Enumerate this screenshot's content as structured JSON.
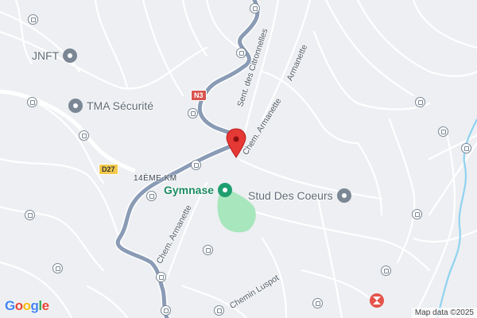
{
  "map": {
    "pois": {
      "jnft": "JNFT",
      "tma": "TMA Sécurité",
      "gymnase": "Gymnase",
      "stud": "Stud Des Coeurs"
    },
    "roads": {
      "sent_citronnelles": "Sent. des Citronnelles",
      "armanette": "Armanette",
      "chem_armanette_upper": "Chem. Armanette",
      "chem_armanette_lower": "Chem. Armanette",
      "chemin_luspot": "Chemin Luspot"
    },
    "shields": {
      "n3": "N3",
      "d27": "D27"
    },
    "km_marker": "14ÈME KM",
    "logo": "Google",
    "attribution": "Map data ©2025",
    "colors": {
      "main_road": "#8a9bb5",
      "marker": "#e53935",
      "park": "#a8e6bd",
      "river": "#8fd3f0"
    }
  }
}
